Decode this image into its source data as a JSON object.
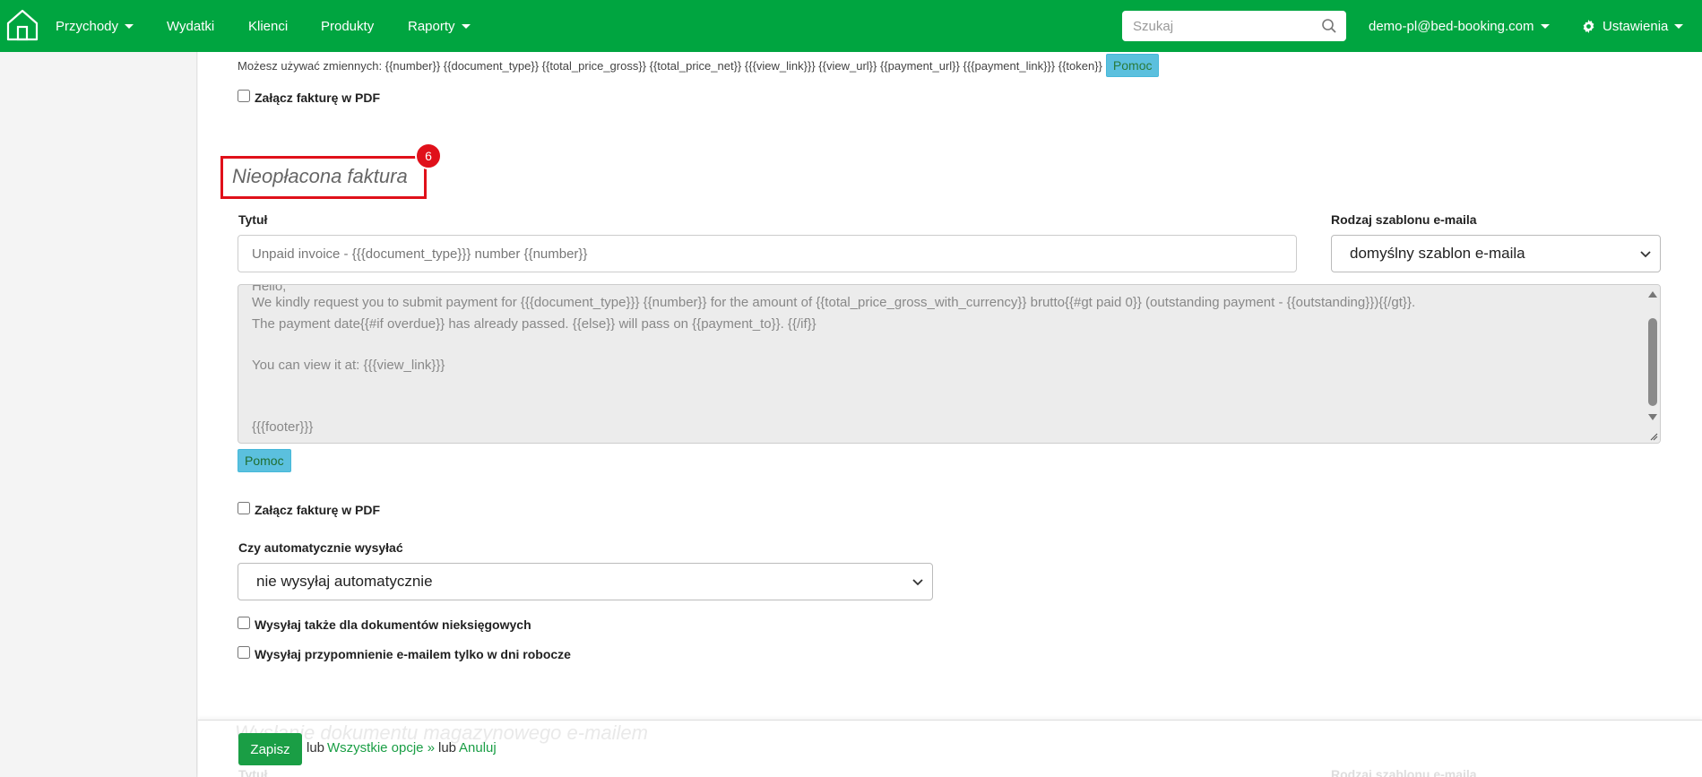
{
  "navbar": {
    "home_icon": "home-icon",
    "items": [
      {
        "label": "Przychody",
        "dropdown": true
      },
      {
        "label": "Wydatki",
        "dropdown": false
      },
      {
        "label": "Klienci",
        "dropdown": false
      },
      {
        "label": "Produkty",
        "dropdown": false
      },
      {
        "label": "Raporty",
        "dropdown": true
      }
    ],
    "search_placeholder": "Szukaj",
    "user_label": "demo-pl@bed-booking.com",
    "settings_label": "Ustawienia",
    "color": "#00a540"
  },
  "top_section": {
    "vars_text": "Możesz używać zmiennych: {{number}} {{document_type}} {{total_price_gross}} {{total_price_net}} {{{view_link}}} {{view_url}} {{payment_url}} {{{payment_link}}} {{token}}",
    "help_label": "Pomoc",
    "attach_pdf_label": "Załącz fakturę w PDF"
  },
  "unpaid_section": {
    "title": "Nieopłacona faktura",
    "badge": "6",
    "highlight_color": "#e0101a",
    "title_label": "Tytuł",
    "title_value": "Unpaid invoice - {{{document_type}}} number {{number}}",
    "template_label": "Rodzaj szablonu e-maila",
    "template_value": "domyślny szablon e-maila",
    "body_lines": [
      "Hello,",
      "We kindly request you to submit payment for {{{document_type}}} {{number}} for the amount of {{total_price_gross_with_currency}} brutto{{#gt paid 0}} (outstanding payment - {{outstanding}}){{/gt}}.",
      "The payment date{{#if overdue}} has already passed. {{else}} will pass on {{payment_to}}. {{/if}}",
      "",
      "You can view it at: {{{view_link}}}",
      "",
      "",
      "{{{footer}}}"
    ],
    "help_label": "Pomoc",
    "attach_pdf_label": "Załącz fakturę w PDF",
    "auto_send_label": "Czy automatycznie wysyłać",
    "auto_send_value": "nie wysyłaj automatycznie",
    "non_accounting_label": "Wysyłaj także dla dokumentów nieksięgowych",
    "workdays_label": "Wysyłaj przypomnienie e-mailem tylko w dni robocze"
  },
  "next_section": {
    "title": "Wysłanie dokumentu magazynowego e-mailem",
    "title_label": "Tytuł",
    "template_label": "Rodzaj szablonu e-maila"
  },
  "footer": {
    "save_label": "Zapisz",
    "or1": "lub",
    "all_options_label": "Wszystkie opcje »",
    "or2": "lub",
    "cancel_label": "Anuluj",
    "accent": "#1a9e45"
  }
}
